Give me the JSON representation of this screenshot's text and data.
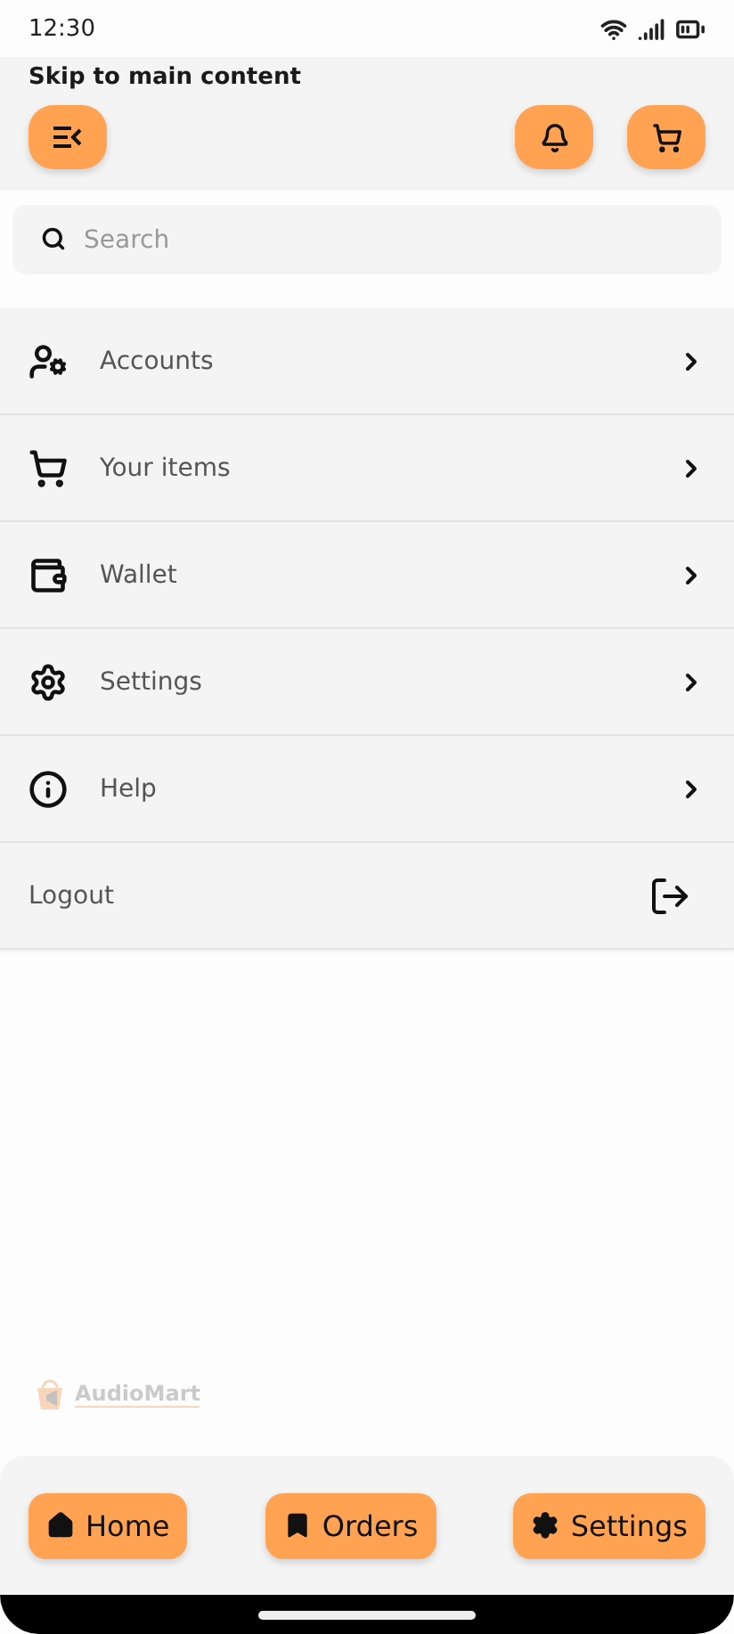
{
  "status_bar": {
    "time": "12:30"
  },
  "header": {
    "skip_link": "Skip to main content"
  },
  "search": {
    "placeholder": "Search"
  },
  "menu": [
    {
      "kind": "link",
      "label": "Accounts"
    },
    {
      "kind": "link",
      "label": "Your items"
    },
    {
      "kind": "link",
      "label": "Wallet"
    },
    {
      "kind": "link",
      "label": "Settings"
    },
    {
      "kind": "link",
      "label": "Help"
    },
    {
      "kind": "logout",
      "label": "Logout"
    }
  ],
  "logo": {
    "text": "AudioMart"
  },
  "bottom_nav": [
    {
      "label": "Home"
    },
    {
      "label": "Orders"
    },
    {
      "label": "Settings"
    }
  ]
}
